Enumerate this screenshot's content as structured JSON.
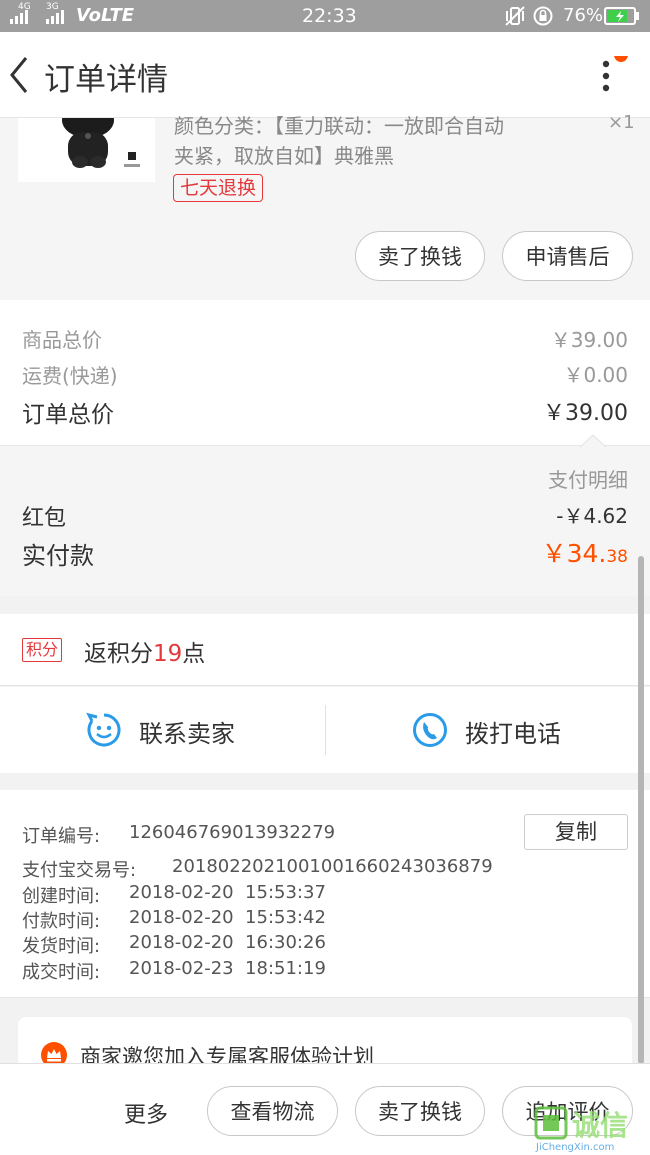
{
  "status_bar": {
    "signal1": "4G",
    "signal2": "3G",
    "volte": "VoLTE",
    "time": "22:33",
    "battery": "76%"
  },
  "header": {
    "title": "订单详情"
  },
  "product": {
    "spec_line1": "颜色分类：【重力联动：一放即合自动",
    "spec_line2": "夹紧，取放自如】典雅黑",
    "tag": "七天退换",
    "qty": "×1"
  },
  "product_actions": {
    "sell": "卖了换钱",
    "after_sale": "申请售后"
  },
  "price": {
    "goods_label": "商品总价",
    "goods_value": "￥39.00",
    "shipping_label": "运费(快递)",
    "shipping_value": "￥0.00",
    "total_label": "订单总价",
    "total_value": "￥39.00"
  },
  "payment": {
    "detail_label": "支付明细",
    "redpacket_label": "红包",
    "redpacket_value": "-￥4.62",
    "paid_label": "实付款",
    "paid_main": "￥34.",
    "paid_decimal": "38"
  },
  "points": {
    "badge": "积分",
    "prefix": "返积分",
    "count": "19",
    "suffix": "点"
  },
  "contact": {
    "seller": "联系卖家",
    "phone": "拨打电话"
  },
  "order_info": {
    "copy": "复制",
    "rows": [
      {
        "label": "订单编号:",
        "value": "126046769013932279"
      },
      {
        "label": "支付宝交易号:",
        "value": "2018022021001001660243036879"
      },
      {
        "label": "创建时间:",
        "value": "2018-02-20  15:53:37"
      },
      {
        "label": "付款时间:",
        "value": "2018-02-20  15:53:42"
      },
      {
        "label": "发货时间:",
        "value": "2018-02-20  16:30:26"
      },
      {
        "label": "成交时间:",
        "value": "2018-02-23  18:51:19"
      }
    ]
  },
  "promo": {
    "text": "商家邀您加入专属客服体验计划"
  },
  "bottom_bar": {
    "more": "更多",
    "logistics": "查看物流",
    "sell": "卖了换钱",
    "review": "追加评价"
  },
  "watermark": {
    "brand": "诚信",
    "url": "JiChengXin.com"
  },
  "colors": {
    "accent_orange": "#ff5000",
    "points_red": "#e4393c",
    "icon_blue": "#2a9be8"
  }
}
